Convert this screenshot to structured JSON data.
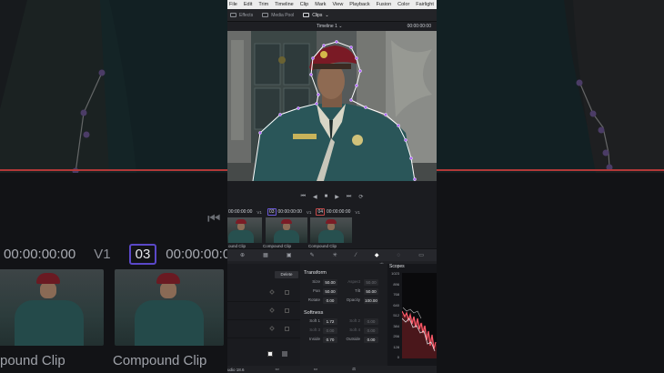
{
  "menu": [
    "File",
    "Edit",
    "Trim",
    "Timeline",
    "Clip",
    "Mark",
    "View",
    "Playback",
    "Fusion",
    "Color",
    "Fairlight"
  ],
  "toolbar": {
    "items": [
      {
        "label": "Effects",
        "icon": "effects-icon"
      },
      {
        "label": "Media Pool",
        "icon": "media-pool-icon"
      },
      {
        "label": "Clips",
        "icon": "clips-icon"
      }
    ]
  },
  "viewer": {
    "timeline_name": "Timeline 1",
    "timecode": "00:00:00:00",
    "chevron": "⌄"
  },
  "transport": {
    "skip_start": "⏮",
    "prev_frame": "◀",
    "stop": "■",
    "play": "▶",
    "skip_end": "⏭",
    "loop": "⟳"
  },
  "clips": [
    {
      "timecode": "00:00:00:00",
      "track": "V1",
      "number": "",
      "label": "ound Clip"
    },
    {
      "timecode": "00:00:00:00",
      "track": "V1",
      "number": "03",
      "label": "Compound Clip"
    },
    {
      "timecode": "00:00:00:00",
      "track": "V1",
      "number": "04",
      "label": "Compound Clip"
    }
  ],
  "background": {
    "left_timecode": "00:00:00:00",
    "track": "V1",
    "clip_number": "03",
    "right_timecode": "00:00:00:00",
    "clip_labels": [
      "pound Clip",
      "Compound Clip"
    ]
  },
  "tools": [
    "⊕",
    "▦",
    "▣",
    "✎",
    "✳",
    "⁄",
    "◆",
    "◌",
    "▭"
  ],
  "subtools": [
    "⟲",
    "⋯"
  ],
  "inspector": {
    "delete_label": "Delete",
    "transform": {
      "title": "Transform",
      "rows": [
        {
          "l1": "Size",
          "v1": "50.00",
          "l2": "Aspect",
          "v2": "50.00",
          "dim2": true
        },
        {
          "l1": "Pan",
          "v1": "50.00",
          "l2": "Tilt",
          "v2": "50.00",
          "dim2": false
        },
        {
          "l1": "Rotate",
          "v1": "0.00",
          "l2": "Opacity",
          "v2": "100.00",
          "dim2": false
        }
      ]
    },
    "softness": {
      "title": "Softness",
      "rows": [
        {
          "l1": "Soft 1",
          "v1": "1.72",
          "l2": "Soft 2",
          "v2": "0.00",
          "dim1": false,
          "dim2": true
        },
        {
          "l1": "Soft 3",
          "v1": "0.00",
          "l2": "Soft 4",
          "v2": "0.00",
          "dim1": true,
          "dim2": true
        },
        {
          "l1": "Inside",
          "v1": "0.70",
          "l2": "Outside",
          "v2": "0.00",
          "dim1": false,
          "dim2": false
        }
      ]
    }
  },
  "scopes": {
    "title": "Scopes",
    "ticks": [
      "1023",
      "896",
      "768",
      "640",
      "512",
      "384",
      "256",
      "128",
      "0"
    ]
  },
  "status": {
    "app": "udio 18.6",
    "icons": [
      "▭",
      "▭",
      "⚖",
      "⚙"
    ]
  },
  "colors": {
    "mask_outline": "#ffffff",
    "mask_point": "#b46cff",
    "playhead": "#c13a3a",
    "clip_badge": "#6a58d8"
  }
}
